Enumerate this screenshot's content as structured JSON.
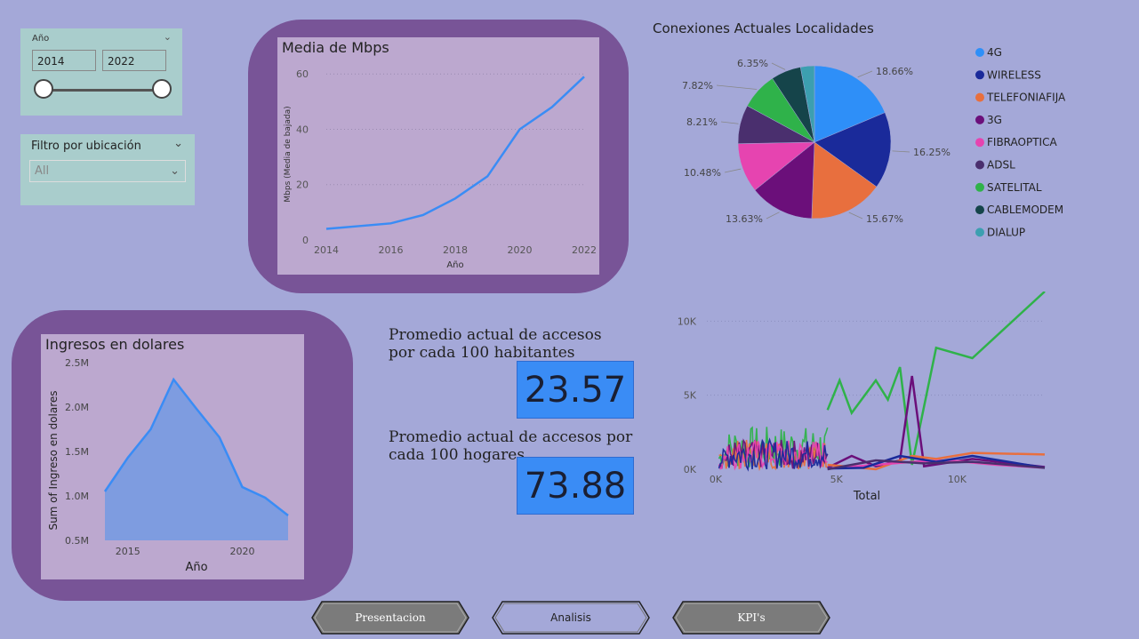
{
  "year_slicer": {
    "label": "Año",
    "start": "2014",
    "end": "2022",
    "range_fraction": [
      0,
      1
    ]
  },
  "location_filter": {
    "label": "Filtro por ubicación",
    "selected": "All"
  },
  "mbps_chart": {
    "title": "Media de Mbps",
    "chart_data": {
      "type": "line",
      "x": [
        2014,
        2015,
        2016,
        2017,
        2018,
        2019,
        2020,
        2021,
        2022
      ],
      "y": [
        4,
        5,
        6,
        9,
        15,
        23,
        40,
        48,
        59
      ],
      "xlabel": "Año",
      "ylabel": "Mbps (Media de bajada)",
      "xticks": [
        "2014",
        "2016",
        "2018",
        "2020",
        "2022"
      ],
      "yticks": [
        "0",
        "20",
        "40",
        "60"
      ],
      "ylim": [
        0,
        62
      ],
      "color": "#3a8cf5"
    }
  },
  "income_chart": {
    "title": "Ingresos en dolares",
    "chart_data": {
      "type": "area",
      "x": [
        2014,
        2015,
        2016,
        2017,
        2018,
        2019,
        2020,
        2021,
        2022
      ],
      "y": [
        1.05,
        1.43,
        1.75,
        2.31,
        1.98,
        1.66,
        1.1,
        0.98,
        0.78
      ],
      "xlabel": "Año",
      "ylabel": "Sum of Ingreso en dolares",
      "xticks": [
        "2015",
        "2020"
      ],
      "yticks": [
        "0.5M",
        "1.0M",
        "1.5M",
        "2.0M",
        "2.5M"
      ],
      "ylim": [
        0.5,
        2.5
      ],
      "color": "#3a8cf5"
    }
  },
  "pie_chart": {
    "title": "Conexiones Actuales Localidades",
    "chart_data": {
      "type": "pie",
      "slices": [
        {
          "name": "4G",
          "value": 18.66,
          "label": "18.66%",
          "color": "#2e8ff8"
        },
        {
          "name": "WIRELESS",
          "value": 16.25,
          "label": "16.25%",
          "color": "#1a2a9a"
        },
        {
          "name": "TELEFONIAFIJA",
          "value": 15.67,
          "label": "15.67%",
          "color": "#e86f3e"
        },
        {
          "name": "3G",
          "value": 13.63,
          "label": "13.63%",
          "color": "#6b0f7a"
        },
        {
          "name": "FIBRAOPTICA",
          "value": 10.48,
          "label": "10.48%",
          "color": "#e644b0"
        },
        {
          "name": "ADSL",
          "value": 8.21,
          "label": "8.21%",
          "color": "#4a2f6e"
        },
        {
          "name": "SATELITAL",
          "value": 7.82,
          "label": "7.82%",
          "color": "#2fb24a"
        },
        {
          "name": "CABLEMODEM",
          "value": 6.35,
          "label": "6.35%",
          "color": "#15444a"
        },
        {
          "name": "DIALUP",
          "value": 2.93,
          "label": "",
          "color": "#3c9fb0"
        }
      ]
    }
  },
  "line_chart": {
    "chart_data": {
      "type": "line",
      "xlabel": "Total",
      "xticks": [
        "0K",
        "5K",
        "10K"
      ],
      "yticks": [
        "0K",
        "5K",
        "10K"
      ],
      "xlim": [
        0,
        14000
      ],
      "ylim": [
        0,
        12000
      ],
      "series": [
        {
          "color": "#2fb24a",
          "points": [
            [
              5000,
              4000
            ],
            [
              5500,
              6000
            ],
            [
              6000,
              3800
            ],
            [
              7000,
              6000
            ],
            [
              7500,
              4700
            ],
            [
              8000,
              6900
            ],
            [
              8500,
              300
            ],
            [
              9500,
              8200
            ],
            [
              11000,
              7500
            ],
            [
              14000,
              12000
            ]
          ]
        },
        {
          "color": "#6b0f7a",
          "points": [
            [
              5000,
              100
            ],
            [
              6000,
              900
            ],
            [
              7000,
              200
            ],
            [
              8000,
              600
            ],
            [
              8500,
              6300
            ],
            [
              9000,
              200
            ],
            [
              11000,
              700
            ],
            [
              14000,
              150
            ]
          ]
        },
        {
          "color": "#e86f3e",
          "points": [
            [
              5000,
              300
            ],
            [
              7000,
              0
            ],
            [
              8500,
              900
            ],
            [
              9500,
              700
            ],
            [
              11000,
              1100
            ],
            [
              14000,
              1000
            ]
          ]
        },
        {
          "color": "#e644b0",
          "points": [
            [
              5000,
              50
            ],
            [
              7000,
              300
            ],
            [
              8500,
              500
            ],
            [
              10000,
              600
            ],
            [
              12000,
              300
            ],
            [
              14000,
              100
            ]
          ]
        },
        {
          "color": "#1a2a9a",
          "points": [
            [
              5000,
              50
            ],
            [
              6500,
              100
            ],
            [
              8000,
              900
            ],
            [
              9500,
              500
            ],
            [
              11000,
              900
            ],
            [
              14000,
              100
            ]
          ]
        },
        {
          "color": "#4a2f6e",
          "points": [
            [
              5000,
              0
            ],
            [
              7000,
              600
            ],
            [
              9000,
              400
            ],
            [
              11000,
              500
            ],
            [
              14000,
              100
            ]
          ]
        }
      ]
    }
  },
  "kpi_habitantes": {
    "label_line1": "Promedio actual de accesos",
    "label_line2": "por cada 100 habitantes",
    "value": "23.57"
  },
  "kpi_hogares": {
    "label_line1": "Promedio actual de accesos por",
    "label_line2": "cada 100 hogares",
    "value": "73.88"
  },
  "nav": {
    "presentacion": "Presentacion",
    "analisis": "Analisis",
    "kpis": "KPI's"
  }
}
